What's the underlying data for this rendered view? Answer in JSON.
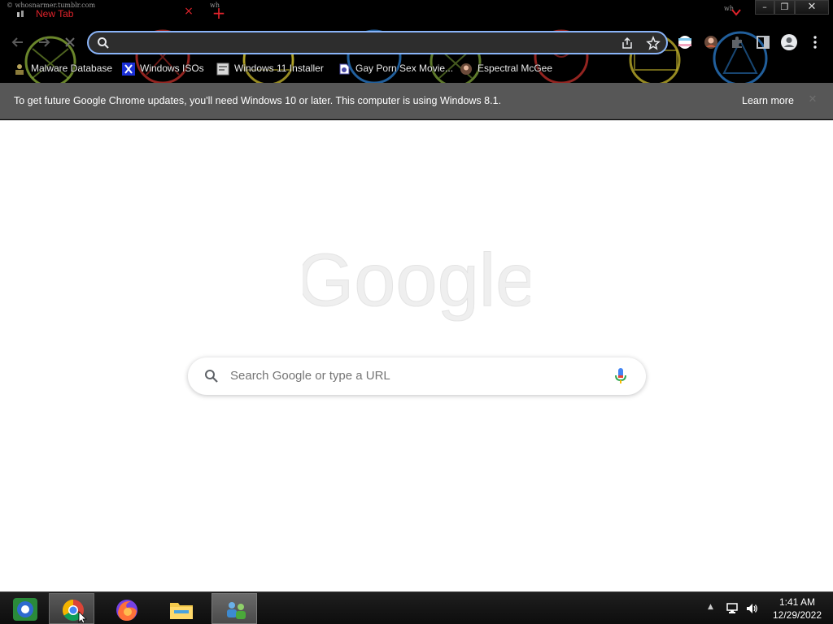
{
  "window": {
    "credit_left": "© whosnarmer.tumblr.com",
    "credit_mid": "wh",
    "credit_right": "wh"
  },
  "tab": {
    "title": "New Tab",
    "close_glyph": "×",
    "accent_color": "#e0232b"
  },
  "window_controls": {
    "minimize": "–",
    "restore": "❐",
    "close": "✕"
  },
  "toolbar": {
    "back_icon": "arrow-left-icon",
    "forward_icon": "arrow-right-icon",
    "stop_icon": "close-icon",
    "address_value": "",
    "extensions": [
      "flag-extension-icon",
      "profile-extension-icon",
      "puzzle-icon",
      "side-panel-icon",
      "account-icon",
      "kebab-menu-icon"
    ]
  },
  "bookmarks": [
    {
      "label": "Malware Database",
      "icon": "malware-db-icon"
    },
    {
      "label": "Windows ISOs",
      "icon": "x-logo-icon"
    },
    {
      "label": "Windows 11 Installer",
      "icon": "installer-page-icon"
    },
    {
      "label": "Gay Porn Sex Movie...",
      "icon": "sites-icon"
    },
    {
      "label": "Espectral McGee",
      "icon": "avatar-icon"
    }
  ],
  "infobar": {
    "message": "To get future Google Chrome updates, you'll need Windows 10 or later. This computer is using Windows 8.1.",
    "learn_more": "Learn more",
    "close_glyph": "✕"
  },
  "ntp": {
    "logo_text": "Google",
    "search_placeholder": "Search Google or type a URL"
  },
  "taskbar": {
    "items": [
      "start-icon",
      "chrome-icon",
      "firefox-icon",
      "file-explorer-icon",
      "network-users-icon"
    ],
    "time": "1:41 AM",
    "date": "12/29/2022",
    "tray_expand": "▲"
  }
}
